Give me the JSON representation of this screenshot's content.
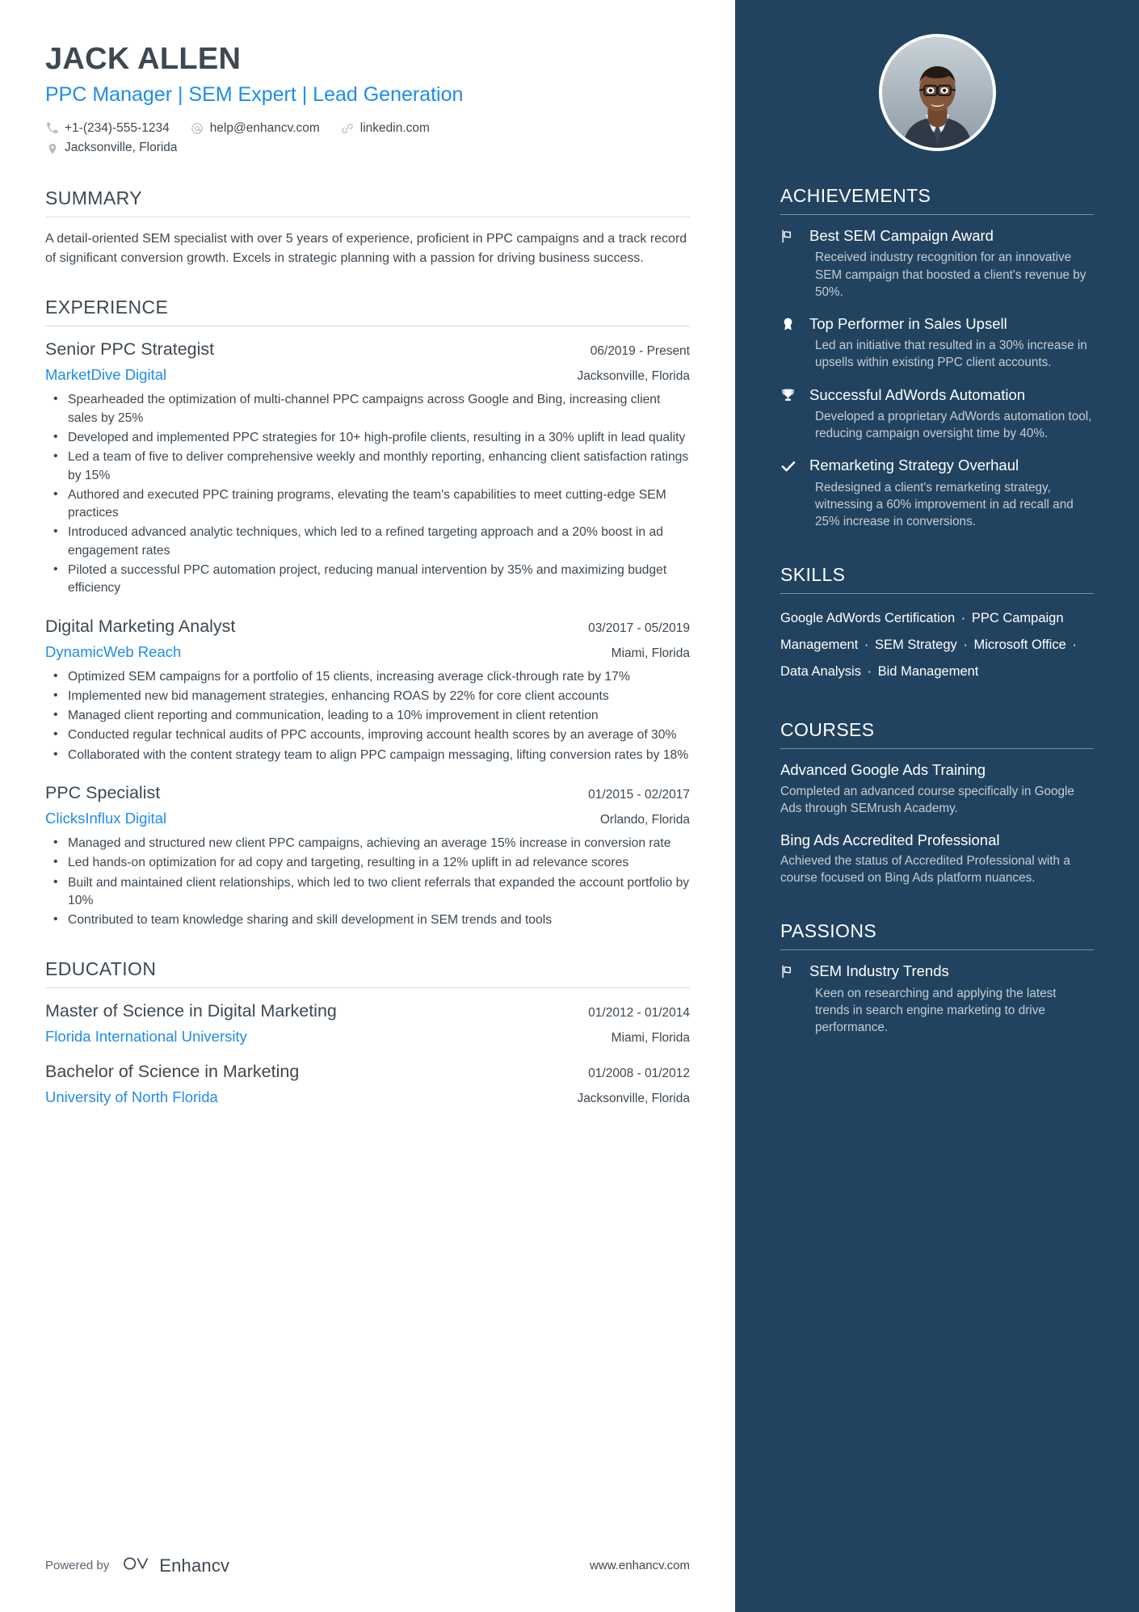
{
  "colors": {
    "accent_blue": "#1f8ceb",
    "sidebar_bg": "#22435f",
    "text_dark": "#3d4852",
    "muted_light": "#c3cdd6"
  },
  "header": {
    "name": "JACK ALLEN",
    "headline": "PPC Manager | SEM Expert | Lead Generation",
    "contacts": [
      {
        "icon": "phone-icon",
        "value": "+1-(234)-555-1234"
      },
      {
        "icon": "at-icon",
        "value": "help@enhancv.com"
      },
      {
        "icon": "link-icon",
        "value": "linkedin.com"
      }
    ],
    "location": {
      "icon": "location-pin-icon",
      "value": "Jacksonville, Florida"
    }
  },
  "summary": {
    "title": "SUMMARY",
    "text": "A detail-oriented SEM specialist with over 5 years of experience, proficient in PPC campaigns and a track record of significant conversion growth. Excels in strategic planning with a passion for driving business success."
  },
  "experience": {
    "title": "EXPERIENCE",
    "jobs": [
      {
        "title": "Senior PPC Strategist",
        "dates": "06/2019 - Present",
        "company": "MarketDive Digital",
        "location": "Jacksonville, Florida",
        "bullets": [
          "Spearheaded the optimization of multi-channel PPC campaigns across Google and Bing, increasing client sales by 25%",
          "Developed and implemented PPC strategies for 10+ high-profile clients, resulting in a 30% uplift in lead quality",
          "Led a team of five to deliver comprehensive weekly and monthly reporting, enhancing client satisfaction ratings by 15%",
          "Authored and executed PPC training programs, elevating the team's capabilities to meet cutting-edge SEM practices",
          "Introduced advanced analytic techniques, which led to a refined targeting approach and a 20% boost in ad engagement rates",
          "Piloted a successful PPC automation project, reducing manual intervention by 35% and maximizing budget efficiency"
        ]
      },
      {
        "title": "Digital Marketing Analyst",
        "dates": "03/2017 - 05/2019",
        "company": "DynamicWeb Reach",
        "location": "Miami, Florida",
        "bullets": [
          "Optimized SEM campaigns for a portfolio of 15 clients, increasing average click-through rate by 17%",
          "Implemented new bid management strategies, enhancing ROAS by 22% for core client accounts",
          "Managed client reporting and communication, leading to a 10% improvement in client retention",
          "Conducted regular technical audits of PPC accounts, improving account health scores by an average of 30%",
          "Collaborated with the content strategy team to align PPC campaign messaging, lifting conversion rates by 18%"
        ]
      },
      {
        "title": "PPC Specialist",
        "dates": "01/2015 - 02/2017",
        "company": "ClicksInflux Digital",
        "location": "Orlando, Florida",
        "bullets": [
          "Managed and structured new client PPC campaigns, achieving an average 15% increase in conversion rate",
          "Led hands-on optimization for ad copy and targeting, resulting in a 12% uplift in ad relevance scores",
          "Built and maintained client relationships, which led to two client referrals that expanded the account portfolio by 10%",
          "Contributed to team knowledge sharing and skill development in SEM trends and tools"
        ]
      }
    ]
  },
  "education": {
    "title": "EDUCATION",
    "entries": [
      {
        "degree": "Master of Science in Digital Marketing",
        "dates": "01/2012 - 01/2014",
        "school": "Florida International University",
        "location": "Miami, Florida"
      },
      {
        "degree": "Bachelor of Science in Marketing",
        "dates": "01/2008 - 01/2012",
        "school": "University of North Florida",
        "location": "Jacksonville, Florida"
      }
    ]
  },
  "footer": {
    "powered_by": "Powered by",
    "brand": "Enhancv",
    "url": "www.enhancv.com"
  },
  "achievements": {
    "title": "ACHIEVEMENTS",
    "items": [
      {
        "icon": "flag-icon",
        "title": "Best SEM Campaign Award",
        "desc": "Received industry recognition for an innovative SEM campaign that boosted a client's revenue by 50%."
      },
      {
        "icon": "medal-icon",
        "title": "Top Performer in Sales Upsell",
        "desc": "Led an initiative that resulted in a 30% increase in upsells within existing PPC client accounts."
      },
      {
        "icon": "trophy-icon",
        "title": "Successful AdWords Automation",
        "desc": "Developed a proprietary AdWords automation tool, reducing campaign oversight time by 40%."
      },
      {
        "icon": "check-icon",
        "title": "Remarketing Strategy Overhaul",
        "desc": "Redesigned a client's remarketing strategy, witnessing a 60% improvement in ad recall and 25% increase in conversions."
      }
    ]
  },
  "skills": {
    "title": "SKILLS",
    "items": [
      "Google AdWords Certification",
      "PPC Campaign Management",
      "SEM Strategy",
      "Microsoft Office",
      "Data Analysis",
      "Bid Management"
    ],
    "separator": "·"
  },
  "courses": {
    "title": "COURSES",
    "items": [
      {
        "title": "Advanced Google Ads Training",
        "desc": "Completed an advanced course specifically in Google Ads through SEMrush Academy."
      },
      {
        "title": "Bing Ads Accredited Professional",
        "desc": "Achieved the status of Accredited Professional with a course focused on Bing Ads platform nuances."
      }
    ]
  },
  "passions": {
    "title": "PASSIONS",
    "items": [
      {
        "icon": "flag-icon",
        "title": "SEM Industry Trends",
        "desc": "Keen on researching and applying the latest trends in search engine marketing to drive performance."
      }
    ]
  }
}
